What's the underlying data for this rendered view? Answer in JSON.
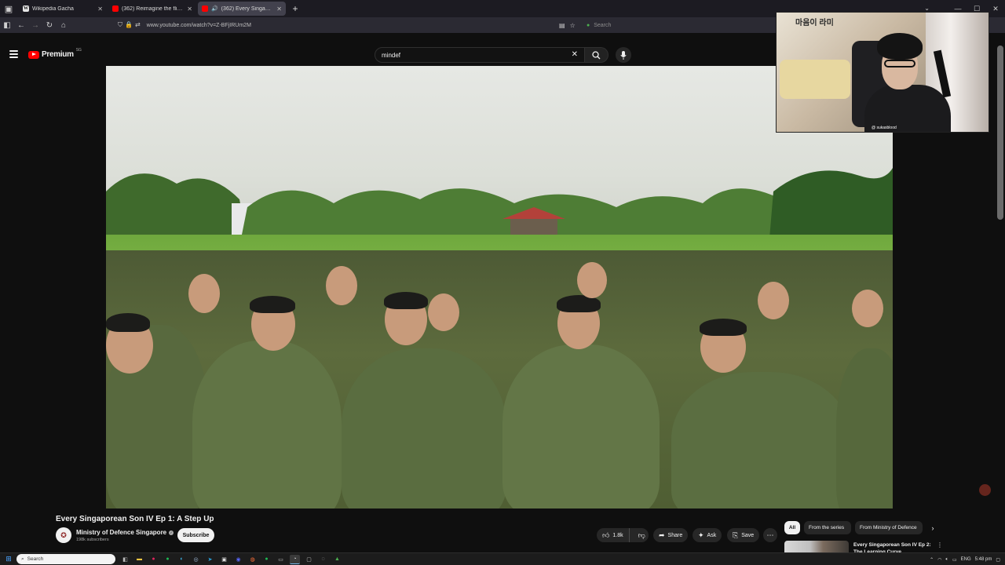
{
  "browser": {
    "tabs": [
      {
        "title": "Wikipedia Gacha",
        "favicon": "wikipedia-icon",
        "active": false
      },
      {
        "title": "(362) Reimagine the flight - ...",
        "favicon": "youtube-icon",
        "active": false
      },
      {
        "title": "(362) Every Singaporean So...",
        "favicon": "youtube-icon",
        "active": true
      }
    ],
    "new_tab_label": "+",
    "url": "www.youtube.com/watch?v=Z-BFjIRUm2M",
    "search_placeholder": "Search"
  },
  "youtube": {
    "logo_text": "Premium",
    "region_code": "SG",
    "search_query": "mindef"
  },
  "webcam": {
    "handle": "@ sukasblood",
    "sign_text": "마음이 라미"
  },
  "video": {
    "title": "Every Singaporean Son IV Ep 1: A Step Up",
    "channel": {
      "name": "Ministry of Defence Singapore",
      "subscribers": "198k subscribers",
      "subscribe_label": "Subscribe"
    },
    "actions": {
      "likes": "1.8k",
      "share_label": "Share",
      "ask_label": "Ask",
      "save_label": "Save"
    }
  },
  "sidebar": {
    "chips": [
      "All",
      "From the series",
      "From Ministry of Defence"
    ],
    "recommendation": {
      "title": "Every Singaporean Son IV Ep 2: The Learning Curve"
    }
  },
  "taskbar": {
    "search_placeholder": "Search",
    "language": "ENG",
    "time": "5:48 pm"
  },
  "colors": {
    "youtube_red": "#ff0000",
    "background": "#0f0f0f",
    "pill_bg": "#272727"
  }
}
